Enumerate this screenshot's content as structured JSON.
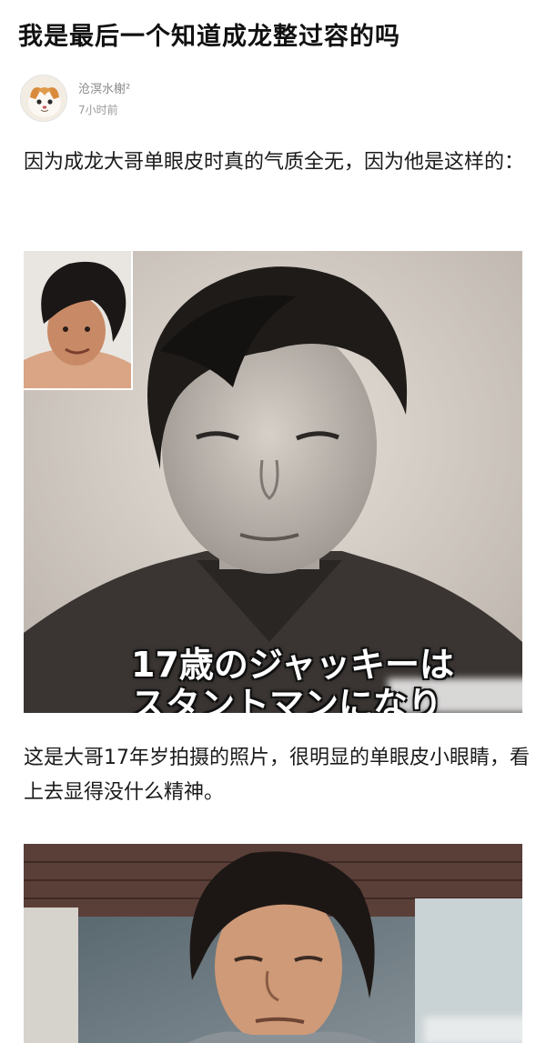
{
  "post": {
    "title": "我是最后一个知道成龙整过容的吗",
    "author_name": "沧溟水榭²",
    "post_time": "7小时前"
  },
  "content": {
    "paragraph_1": "因为成龙大哥单眼皮时真的气质全无，因为他是这样的：",
    "image_1_caption_line1": "17歳のジャッキーは",
    "image_1_caption_line2": "スタントマンになり",
    "paragraph_2": "这是大哥17年岁拍摄的照片，很明显的单眼皮小眼睛，看上去显得没什么精神。"
  },
  "colors": {
    "text": "#1b1b1b",
    "meta": "#8a8a8a",
    "background": "#ffffff"
  },
  "icons": {
    "avatar": "cat-avatar-icon"
  }
}
